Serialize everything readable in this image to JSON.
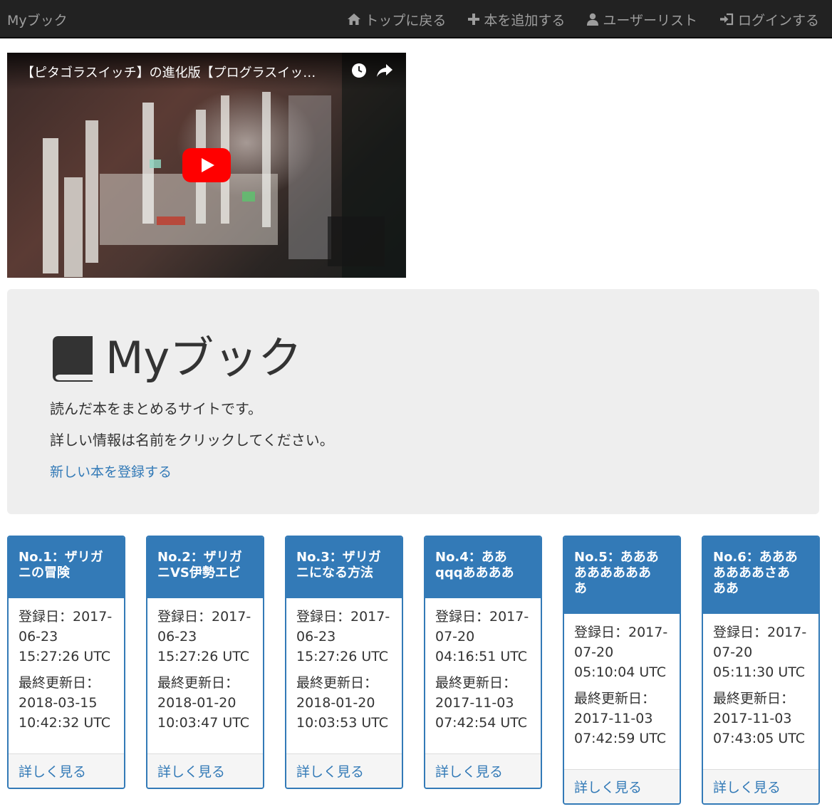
{
  "navbar": {
    "brand": "Myブック",
    "items": [
      {
        "label": "トップに戻る",
        "icon": "home-icon"
      },
      {
        "label": "本を追加する",
        "icon": "plus-icon"
      },
      {
        "label": "ユーザーリスト",
        "icon": "user-icon"
      },
      {
        "label": "ログインする",
        "icon": "log-in-icon"
      }
    ]
  },
  "video": {
    "title": "【ピタゴラスイッチ】の進化版【プログラスイッ…",
    "icons": [
      "clock-icon",
      "share-icon",
      "youtube-play-icon"
    ]
  },
  "jumbotron": {
    "title": "Myブック",
    "icon": "book-icon",
    "description": "読んだ本をまとめるサイトです。",
    "instruction": "詳しい情報は名前をクリックしてください。",
    "new_link": "新しい本を登録する"
  },
  "books": [
    {
      "title_lines": [
        "No.1：ザリガ",
        "ニの冒険"
      ],
      "created_label": "登録日：2017-",
      "created_lines": [
        "06-23",
        "15:27:26 UTC"
      ],
      "updated_label": "最終更新日：",
      "updated_lines": [
        "2018-03-15",
        "10:42:32 UTC"
      ],
      "detail": "詳しく見る"
    },
    {
      "title_lines": [
        "No.2：ザリガ",
        "ニVS伊勢エビ"
      ],
      "created_label": "登録日：2017-",
      "created_lines": [
        "06-23",
        "15:27:26 UTC"
      ],
      "updated_label": "最終更新日：",
      "updated_lines": [
        "2018-01-20",
        "10:03:47 UTC"
      ],
      "detail": "詳しく見る"
    },
    {
      "title_lines": [
        "No.3：ザリガ",
        "ニになる方法"
      ],
      "created_label": "登録日：2017-",
      "created_lines": [
        "06-23",
        "15:27:26 UTC"
      ],
      "updated_label": "最終更新日：",
      "updated_lines": [
        "2018-01-20",
        "10:03:53 UTC"
      ],
      "detail": "詳しく見る"
    },
    {
      "title_lines": [
        "No.4：ああ",
        "qqqああああ"
      ],
      "created_label": "登録日：2017-",
      "created_lines": [
        "07-20",
        "04:16:51 UTC"
      ],
      "updated_label": "最終更新日：",
      "updated_lines": [
        "2017-11-03",
        "07:42:54 UTC"
      ],
      "detail": "詳しく見る"
    },
    {
      "title_lines": [
        "No.5：あああ",
        "ああああああ",
        "あ"
      ],
      "created_label": "登録日：2017-",
      "created_lines": [
        "07-20",
        "05:10:04 UTC"
      ],
      "updated_label": "最終更新日：",
      "updated_lines": [
        "2017-11-03",
        "07:42:59 UTC"
      ],
      "detail": "詳しく見る"
    },
    {
      "title_lines": [
        "No.6：あああ",
        "ああああさあ",
        "ああ"
      ],
      "created_label": "登録日：2017-",
      "created_lines": [
        "07-20",
        "05:11:30 UTC"
      ],
      "updated_label": "最終更新日：",
      "updated_lines": [
        "2017-11-03",
        "07:43:05 UTC"
      ],
      "detail": "詳しく見る"
    }
  ],
  "colors": {
    "navbar_bg": "#222222",
    "nav_text": "#9d9d9d",
    "primary": "#337ab7",
    "jumbotron_bg": "#eeeeee",
    "youtube_red": "#ff0000"
  }
}
